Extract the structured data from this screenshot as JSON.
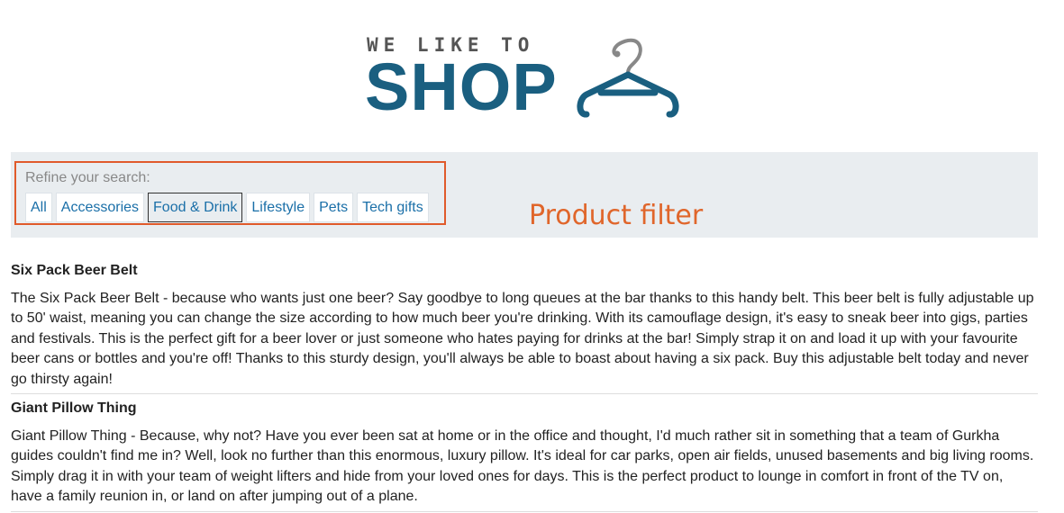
{
  "logo": {
    "tagline": "WE LIKE TO",
    "brand": "SHOP",
    "icon": "hanger-icon",
    "color": "#1a5f80"
  },
  "filter": {
    "label": "Refine your search:",
    "options": [
      "All",
      "Accessories",
      "Food & Drink",
      "Lifestyle",
      "Pets",
      "Tech gifts"
    ],
    "selected": "Food & Drink",
    "highlight_color": "#e05a2b"
  },
  "annotation": "Product filter",
  "products": [
    {
      "title": "Six Pack Beer Belt",
      "description": "The Six Pack Beer Belt - because who wants just one beer? Say goodbye to long queues at the bar thanks to this handy belt. This beer belt is fully adjustable up to 50' waist, meaning you can change the size according to how much beer you're drinking. With its camouflage design, it's easy to sneak beer into gigs, parties and festivals. This is the perfect gift for a beer lover or just someone who hates paying for drinks at the bar! Simply strap it on and load it up with your favourite beer cans or bottles and you're off! Thanks to this sturdy design, you'll always be able to boast about having a six pack. Buy this adjustable belt today and never go thirsty again!"
    },
    {
      "title": "Giant Pillow Thing",
      "description": "Giant Pillow Thing - Because, why not? Have you ever been sat at home or in the office and thought, I'd much rather sit in something that a team of Gurkha guides couldn't find me in? Well, look no further than this enormous, luxury pillow. It's ideal for car parks, open air fields, unused basements and big living rooms. Simply drag it in with your team of weight lifters and hide from your loved ones for days. This is the perfect product to lounge in comfort in front of the TV on, have a family reunion in, or land on after jumping out of a plane."
    }
  ]
}
